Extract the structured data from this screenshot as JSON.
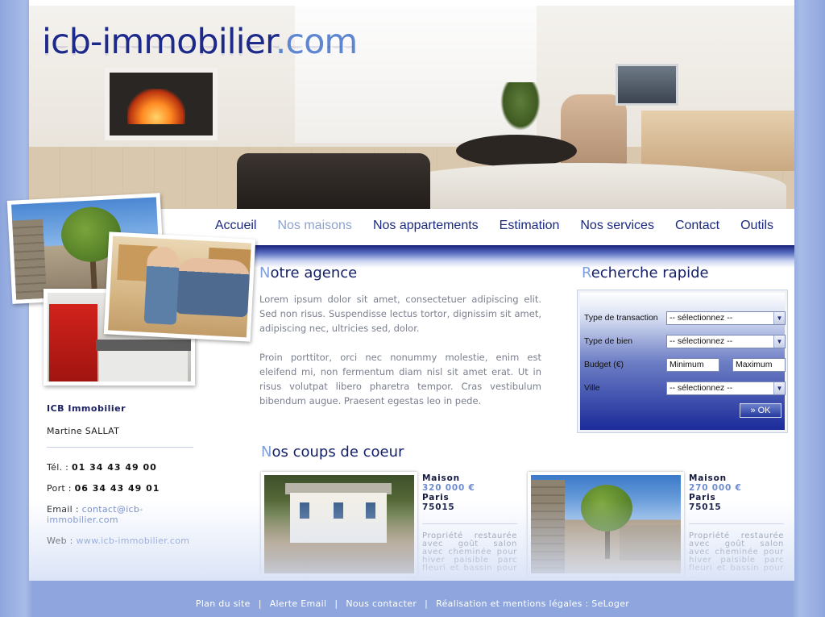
{
  "brand": {
    "name_main": "icb-immobilier",
    "name_tld": ".com"
  },
  "nav": {
    "items": [
      "Accueil",
      "Nos maisons",
      "Nos appartements",
      "Estimation",
      "Nos services",
      "Contact",
      "Outils"
    ],
    "active_index": 1
  },
  "contact": {
    "company": "ICB Immobilier",
    "person": "Martine SALLAT",
    "tel_label": "Tél. :",
    "tel": "01 34 43 49 00",
    "port_label": "Port :",
    "port": "06 34 43 49 01",
    "email_label": "Email :",
    "email": "contact@icb-immobilier.com",
    "web_label": "Web :",
    "web": "www.icb-immobilier.com"
  },
  "agency": {
    "title_first": "N",
    "title_rest": "otre agence",
    "paragraph1": "Lorem ipsum dolor sit amet, consectetuer adipiscing elit. Sed non risus. Suspendisse lectus tortor, dignissim sit amet, adipiscing nec, ultricies sed, dolor.",
    "paragraph2": "Proin porttitor, orci nec nonummy molestie, enim est eleifend mi, non fermentum diam nisl sit amet erat. Ut in risus volutpat libero pharetra tempor. Cras vestibulum bibendum augue. Praesent egestas leo in pede."
  },
  "search": {
    "title_first": "R",
    "title_rest": "echerche rapide",
    "transaction_label": "Type de transaction",
    "transaction_value": "-- sélectionnez --",
    "property_label": "Type de bien",
    "property_value": "-- sélectionnez --",
    "budget_label": "Budget (€)",
    "budget_min_placeholder": "Minimum",
    "budget_max_placeholder": "Maximum",
    "city_label": "Ville",
    "city_value": "-- sélectionnez --",
    "ok_label": "» OK"
  },
  "favorites": {
    "title_first": "N",
    "title_rest": "os coups de coeur",
    "items": [
      {
        "type": "Maison",
        "price": "320 000 €",
        "city": "Paris",
        "zip": "75015",
        "desc": "Propriété restaurée avec goût salon avec cheminée pour hiver paisible parc fleuri et bassin pour ..."
      },
      {
        "type": "Maison",
        "price": "270 000 €",
        "city": "Paris",
        "zip": "75015",
        "desc": "Propriété restaurée avec goût salon avec cheminée pour hiver paisible parc fleuri et bassin pour ..."
      }
    ]
  },
  "footer": {
    "links": [
      "Plan du site",
      "Alerte Email",
      "Nous contacter",
      "Réalisation et mentions légales : SeLoger"
    ],
    "separator": "|"
  },
  "colors": {
    "brand_dark": "#1e2a8a",
    "brand_light": "#5f86d0",
    "nav_active": "#8fa3cf",
    "price": "#6e8bcc",
    "background": "#8ea6dd"
  }
}
